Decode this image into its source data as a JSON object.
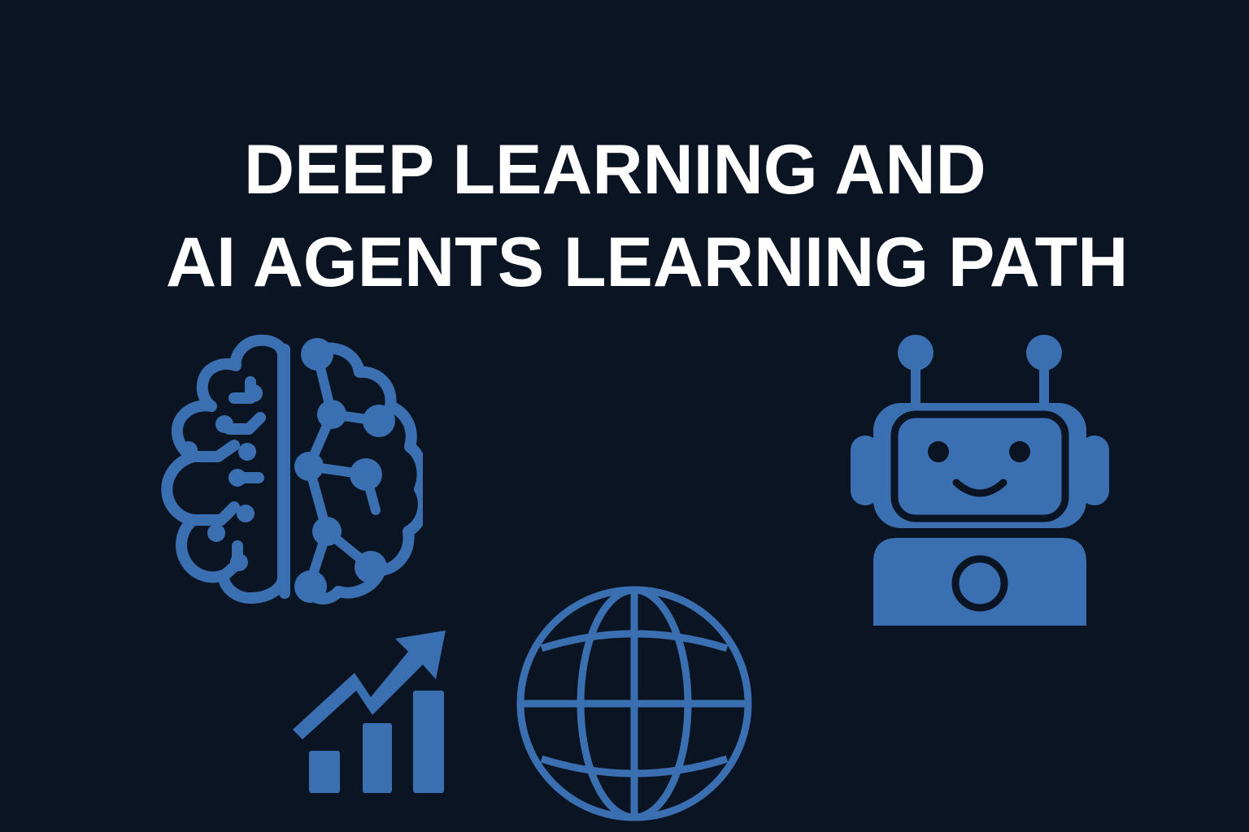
{
  "title": {
    "line1": "DEEP LEARNING AND",
    "line2": "AI AGENTS LEARNING PATH"
  },
  "icons": [
    {
      "name": "brain-circuit-icon"
    },
    {
      "name": "robot-icon"
    },
    {
      "name": "growth-chart-icon"
    },
    {
      "name": "globe-icon"
    }
  ],
  "colors": {
    "background": "#0b1422",
    "title": "#ffffff",
    "accent": "#3a70b2"
  }
}
